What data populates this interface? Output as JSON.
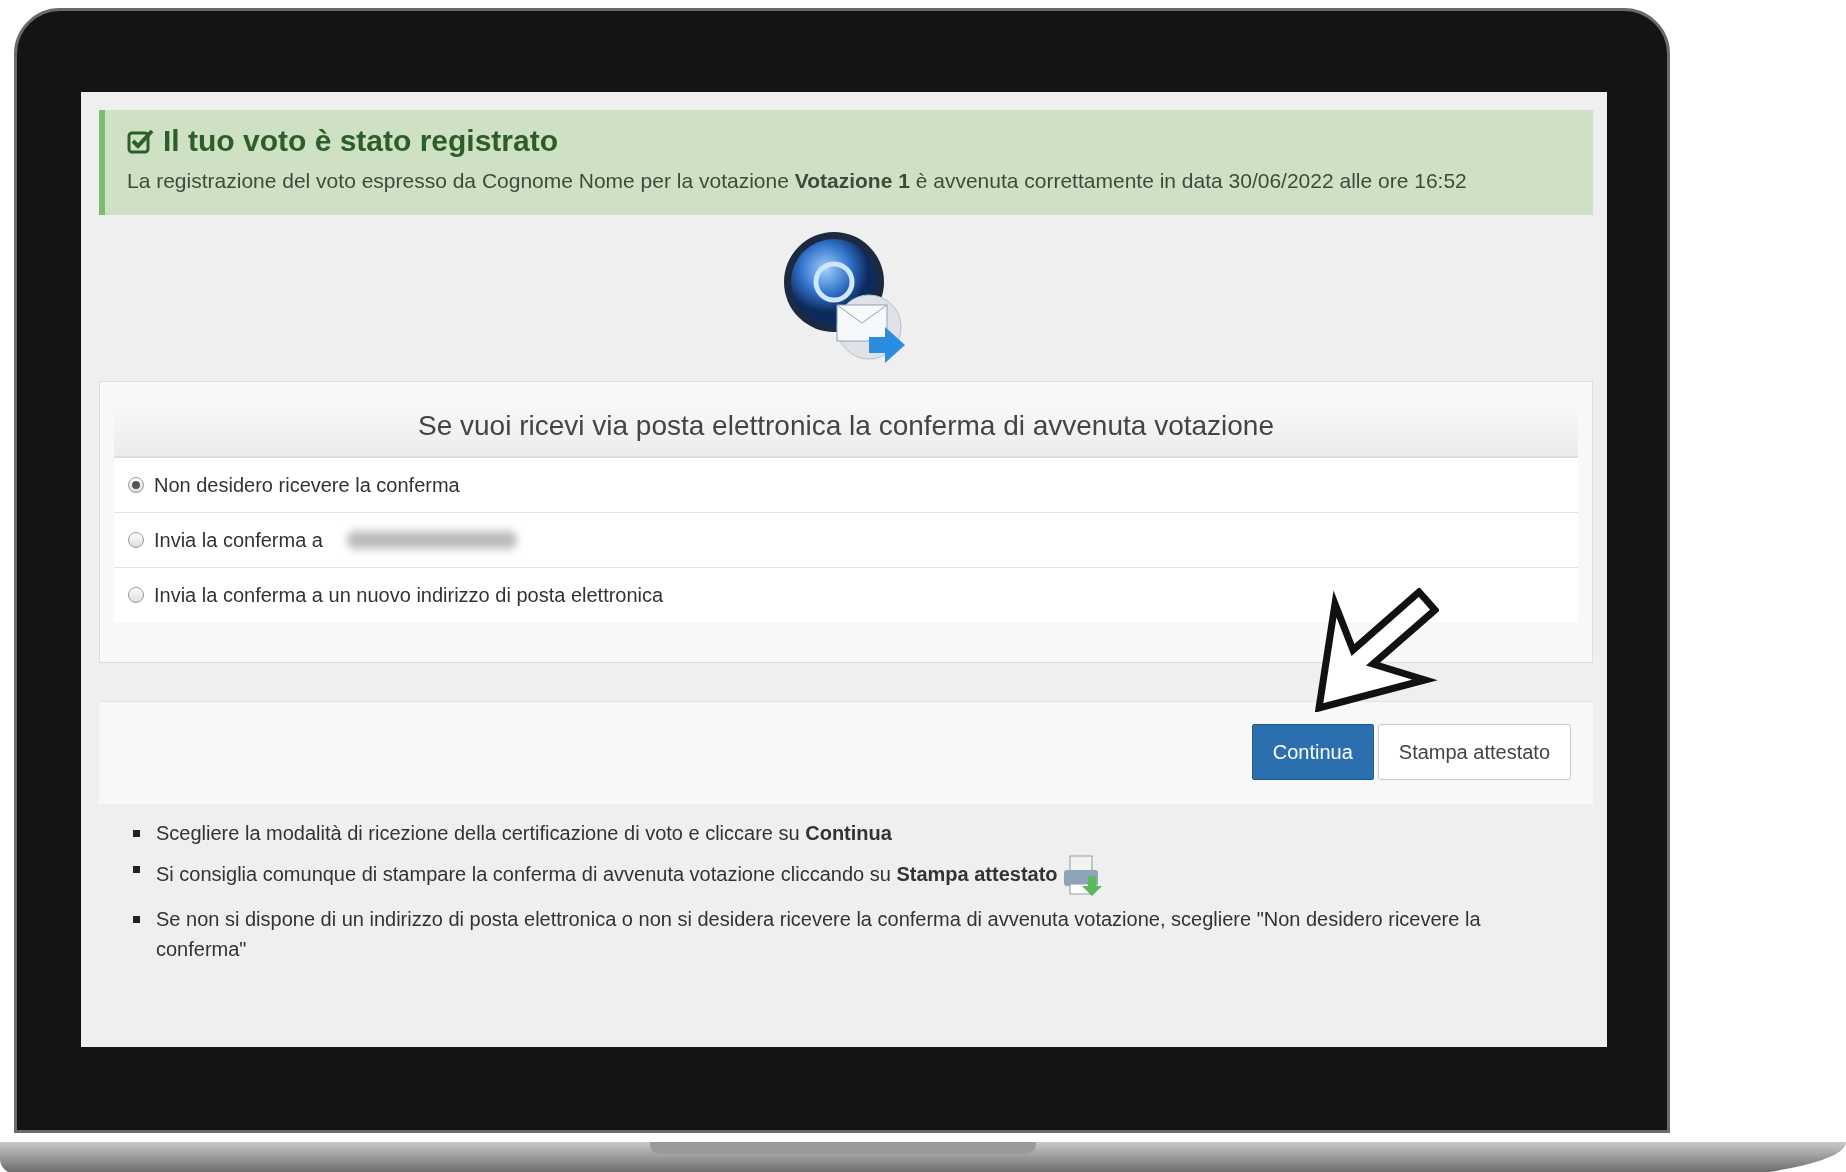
{
  "alert": {
    "title": "Il tuo voto è stato registrato",
    "message": "La registrazione del voto espresso da Cognome Nome per la votazione **Votazione 1** è avvenuta correttamente in data 30/06/2022 alle ore 16:52"
  },
  "email_form": {
    "heading": "Se vuoi ricevi via posta elettronica la conferma di avvenuta votazione",
    "options": [
      {
        "label": "Non desidero ricevere la conferma",
        "selected": true,
        "kind": "plain"
      },
      {
        "label": "Invia la conferma a",
        "selected": false,
        "kind": "address"
      },
      {
        "label": "Invia la conferma a un nuovo indirizzo di posta elettronica",
        "selected": false,
        "kind": "plain"
      }
    ]
  },
  "buttons": [
    {
      "label": "Continua",
      "kind": "primary"
    },
    {
      "label": "Stampa attestato",
      "kind": "default"
    }
  ],
  "notes": [
    {
      "text": "Scegliere la modalità di ricezione della certificazione di voto e cliccare su **Continua**",
      "kind": "text"
    },
    {
      "text": "Si consiglia comunque di stampare la conferma di avvenuta votazione cliccando su **Stampa attestato**",
      "kind": "print"
    },
    {
      "text": "Se non si dispone di un indirizzo di posta elettronica o non si desidera ricevere la conferma di avvenuta votazione, scegliere \"Non desidero ricevere la conferma\"",
      "kind": "text"
    }
  ]
}
